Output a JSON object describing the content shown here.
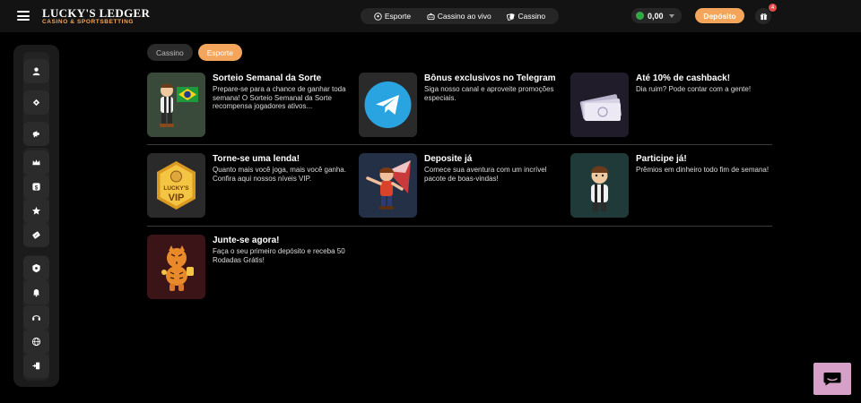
{
  "brand": {
    "name": "LUCKY'S LEDGER",
    "tagline": "CASINO & SPORTSBETTING"
  },
  "nav": [
    {
      "label": "Esporte",
      "icon": "football-icon"
    },
    {
      "label": "Cassino ao vivo",
      "icon": "live-casino-icon"
    },
    {
      "label": "Cassino",
      "icon": "cards-icon"
    }
  ],
  "wallet": {
    "currency_badge": "R$",
    "amount": "0,00"
  },
  "header": {
    "deposit_label": "Depósito",
    "notification_count": "4"
  },
  "tabs": [
    {
      "label": "Cassino",
      "active": false
    },
    {
      "label": "Esporte",
      "active": true
    }
  ],
  "promotions": [
    {
      "title": "Sorteio Semanal da Sorte",
      "description": "Prepare-se para a chance de ganhar toda semana! O Sorteio Semanal da Sorte recompensa jogadores ativos..."
    },
    {
      "title": "Bônus exclusivos no Telegram",
      "description": "Siga nosso canal e aproveite promoções especiais."
    },
    {
      "title": "Até 10% de cashback!",
      "description": "Dia ruim? Pode contar com a gente!"
    },
    {
      "title": "Torne-se uma lenda!",
      "description": "Quanto mais você joga, mais você ganha. Confira aqui nossos níveis VIP."
    },
    {
      "title": "Deposite já",
      "description": "Comece sua aventura com um incrível pacote de boas-vindas!"
    },
    {
      "title": "Participe já!",
      "description": "Prêmios em dinheiro todo fim de semana!"
    },
    {
      "title": "Junte-se agora!",
      "description": "Faça o seu primeiro depósito e receba 50 Rodadas Grátis!"
    }
  ],
  "vip_badge": {
    "line1": "LUCKY'S",
    "line2": "VIP"
  },
  "colors": {
    "accent": "#f3a65b",
    "background": "#000000",
    "topbar": "#131313",
    "sidebar": "#1b1b1b",
    "chat": "#d7a0c8"
  }
}
